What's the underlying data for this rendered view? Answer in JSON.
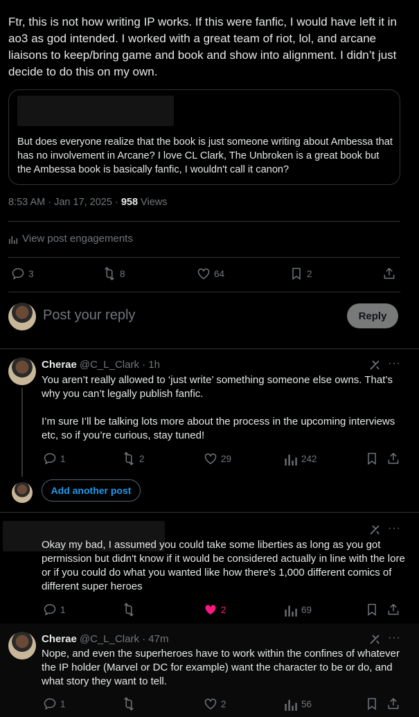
{
  "main_post": {
    "text": "Ftr, this is not how writing IP works. If this were fanfic, I would have left it in ao3 as god intended. I worked with a great team of riot, lol, and arcane liaisons to keep/bring game and book and show into alignment. I didn’t just decide to do this on my own.",
    "quote_text": "But does everyone realize that the book is just someone writing about Ambessa that has no involvement in Arcane? I love CL Clark, The Unbroken is a great book but the Ambessa book is basically fanfic, I wouldn't call it canon?",
    "time": "8:53 AM · Jan 17, 2025 · ",
    "views_count": "958",
    "views_label": " Views",
    "view_engagements": "View post engagements",
    "stats": {
      "replies": "3",
      "reposts": "8",
      "likes": "64",
      "bookmarks": "2"
    }
  },
  "reply_box": {
    "placeholder": "Post your reply",
    "button": "Reply"
  },
  "replies": [
    {
      "name": "Cherae",
      "handle": "@C_L_Clark · 1h",
      "text": "You aren’t really allowed to ‘just write’ something someone else owns. That’s why you can’t legally publish fanfic.\n\nI’m sure I’ll be talking lots more about the process in the upcoming interviews etc, so if you’re curious, stay tuned!",
      "stats": {
        "replies": "1",
        "reposts": "2",
        "likes": "29",
        "views": "242"
      }
    },
    {
      "name": "",
      "handle": "",
      "text": "Okay my bad, I assumed you could take some liberties as long as you got permission but didn't know if it would be considered actually in line with the lore or if you could do what you wanted like how there's 1,000 different comics of different super heroes",
      "stats": {
        "replies": "1",
        "reposts": "",
        "likes": "2",
        "views": "69"
      }
    },
    {
      "name": "Cherae",
      "handle": "@C_L_Clark · 47m",
      "text": "Nope, and even the superheroes have to work within the confines of whatever the IP holder (Marvel or DC for example) want the character to be or do, and what story they want to tell.",
      "stats": {
        "replies": "1",
        "reposts": "",
        "likes": "2",
        "views": "56"
      }
    }
  ],
  "add_another_post": "Add another post",
  "more_glyph": "···",
  "colors": {
    "background": "#000000",
    "text": "#e7e9ea",
    "muted": "#71767b",
    "accent": "#1d9bf0",
    "like": "#f91880"
  }
}
